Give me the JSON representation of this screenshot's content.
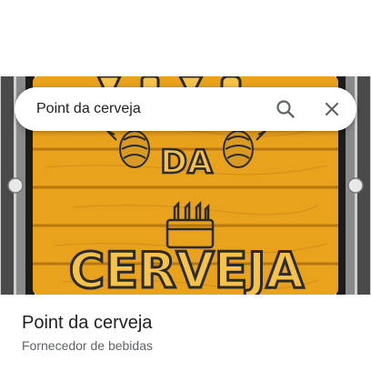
{
  "search": {
    "query": "Point da cerveja",
    "search_icon": "search-icon",
    "close_icon": "close-icon"
  },
  "hero": {
    "logo_line_top": "DA",
    "logo_line_bottom": "CERVEJA",
    "wood_color": "#e8a21c",
    "rim_color": "#5a5a5a"
  },
  "place": {
    "name": "Point da cerveja",
    "category": "Fornecedor de bebidas"
  }
}
